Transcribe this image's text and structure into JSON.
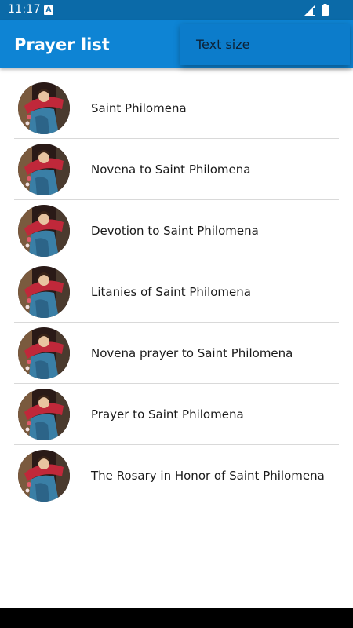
{
  "status_bar": {
    "time": "11:17",
    "notification_glyph": "A"
  },
  "app_bar": {
    "title": "Prayer list"
  },
  "menu": {
    "items": [
      {
        "label": "Text size"
      }
    ]
  },
  "prayers": [
    {
      "label": "Saint Philomena"
    },
    {
      "label": "Novena to Saint Philomena"
    },
    {
      "label": "Devotion to Saint Philomena"
    },
    {
      "label": "Litanies of Saint Philomena"
    },
    {
      "label": "Novena prayer to Saint Philomena"
    },
    {
      "label": "Prayer to Saint Philomena"
    },
    {
      "label": "The Rosary in Honor of Saint Philomena"
    }
  ],
  "colors": {
    "status_bar": "#0b6aa8",
    "app_bar": "#0e84d4",
    "menu": "#0c7ccb",
    "divider": "#d9d9d9"
  }
}
